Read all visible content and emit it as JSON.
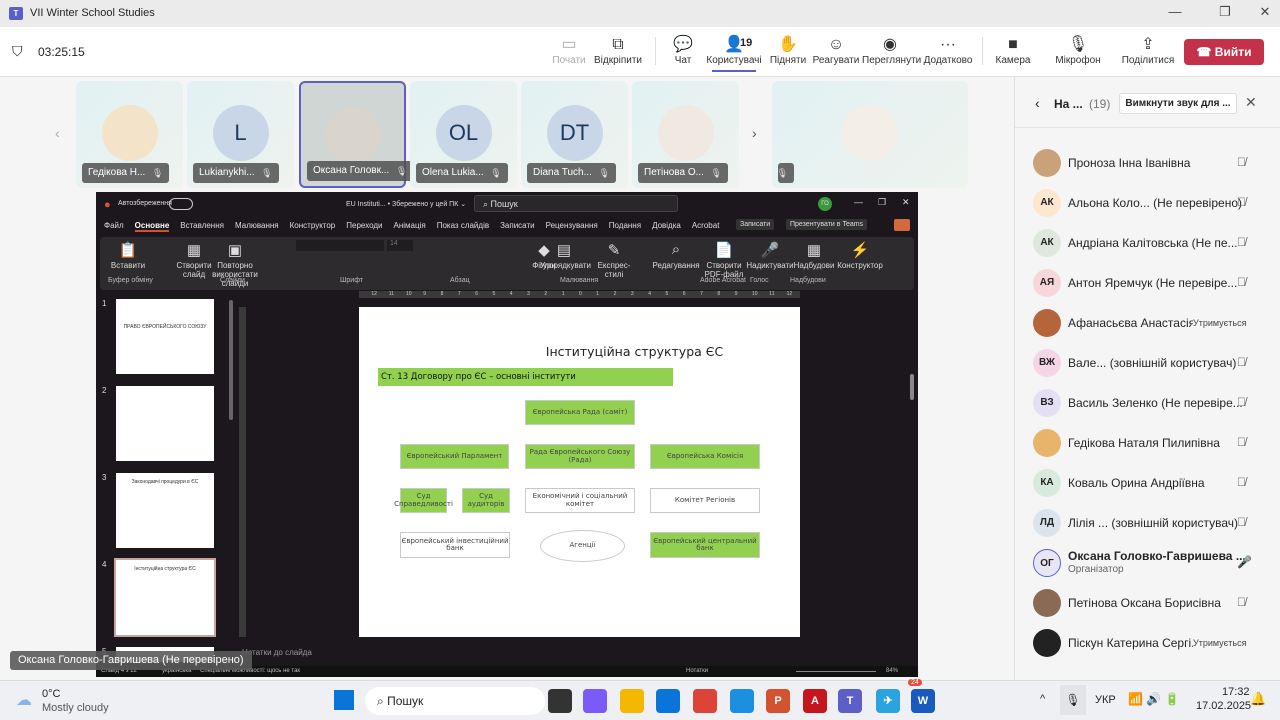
{
  "window": {
    "title": "VII Winter School Studies"
  },
  "meeting": {
    "timer": "03:25:15",
    "participants_count": "19",
    "toolbar": [
      {
        "label": "Почати",
        "icon": "share-screen-icon",
        "disabled": true
      },
      {
        "label": "Відкріпити",
        "icon": "popout-icon"
      },
      {
        "label": "Чат",
        "icon": "chat-icon"
      },
      {
        "label": "Користувачі",
        "icon": "people-icon",
        "active": true
      },
      {
        "label": "Підняти",
        "icon": "raise-hand-icon"
      },
      {
        "label": "Реагувати",
        "icon": "smile-icon"
      },
      {
        "label": "Переглянути",
        "icon": "view-icon"
      },
      {
        "label": "Додатково",
        "icon": "more-icon"
      },
      {
        "label": "Камера",
        "icon": "camera-off-icon"
      },
      {
        "label": "Мікрофон",
        "icon": "mic-off-icon"
      },
      {
        "label": "Поділитися",
        "icon": "share-icon"
      }
    ],
    "leave_label": "Вийти"
  },
  "gallery": [
    {
      "name": "Гедікова Н...",
      "initials": ""
    },
    {
      "name": "Lukianykhi...",
      "initials": "L"
    },
    {
      "name": "Оксана Головк...",
      "initials": ""
    },
    {
      "name": "Olena Lukia...",
      "initials": "OL"
    },
    {
      "name": "Diana Tuch...",
      "initials": "DT"
    },
    {
      "name": "Петінова О...",
      "initials": ""
    }
  ],
  "presenter_label": "Оксана Головко-Гавришева (Не перевірено)",
  "ppt": {
    "autosave": "Автозбереження",
    "filename": "EU Instituti... • Збережено у цей ПК ⌄",
    "search": "Пошук",
    "user_initials": "ГО",
    "tabs": [
      "Файл",
      "Основне",
      "Вставлення",
      "Малювання",
      "Конструктор",
      "Переходи",
      "Анімація",
      "Показ слайдів",
      "Записати",
      "Рецензування",
      "Подання",
      "Довідка",
      "Acrobat"
    ],
    "record_btn": "Записати",
    "teams_btn": "Презентувати в Teams",
    "ribbon_buttons": [
      "Вставити",
      "Створити слайд",
      "Повторно використати слайди",
      "Фігури",
      "Упорядкувати",
      "Експрес-стилі",
      "Редагування",
      "Створити PDF-файл",
      "Надиктувати",
      "Надбудови",
      "Конструктор"
    ],
    "ribbon_groups": [
      "Буфер обміну",
      "Слайди",
      "Шрифт",
      "Абзац",
      "Малювання",
      "Adobe Acrobat",
      "Голос",
      "Надбудови"
    ],
    "font_size": "14",
    "thumbnails": [
      {
        "num": "1",
        "title": "ПРАВО ЄВРОПЕЙСЬКОГО СОЮЗУ"
      },
      {
        "num": "2",
        "title": ""
      },
      {
        "num": "3",
        "title": "Законодавчі процедури в ЄС"
      },
      {
        "num": "4",
        "title": "Інституційна структура ЄС"
      },
      {
        "num": "5",
        "title": ""
      }
    ],
    "notes_placeholder": "Нотатки до слайда",
    "status": {
      "slide": "Слайд 4 з 12",
      "language": "українська",
      "accessibility": "Спеціальні можливості: щось не так",
      "notes": "Нотатки",
      "zoom": "84%"
    },
    "slide": {
      "title": "Інституційна структура ЄС",
      "subtitle": "Ст. 13 Договору про ЄС – основні інститути",
      "boxes": {
        "council_summit": "Європейська Рада (саміт)",
        "parliament": "Європейський Парламент",
        "council": "Рада Європейського Союзу (Рада)",
        "commission": "Європейська Комісія",
        "court_justice": "Суд Справедливості",
        "court_auditors": "Суд аудиторів",
        "ecosoc": "Економічний і соціальний комітет",
        "regions": "Комітет Регіонів",
        "eib": "Європейський інвестиційний банк",
        "agencies": "Агенції",
        "ecb": "Європейський центральний банк"
      }
    }
  },
  "panel": {
    "title": "На ...",
    "count": "(19)",
    "mute_all": "Вимкнути звук для ...",
    "people": [
      {
        "name": "Проноза Інна Іванівна",
        "initials": "",
        "color": "#c9a27a",
        "status": "mic-off"
      },
      {
        "name": "Альона Коло... (Не перевірено)",
        "initials": "АК",
        "color": "#fde7cf",
        "status": "mic-off"
      },
      {
        "name": "Андріана Калітовська (Не пе...",
        "initials": "АК",
        "color": "#dfe8dd",
        "status": "mic-off"
      },
      {
        "name": "Антон Яремчук (Не перевіре...",
        "initials": "АЯ",
        "color": "#f6d8da",
        "status": "mic-off"
      },
      {
        "name": "Афанасьєва Анастасія ...",
        "initials": "",
        "color": "#b5653a",
        "status": "Утримується"
      },
      {
        "name": "Вале...  (зовнішній користувач)",
        "initials": "ВЖ",
        "color": "#f5d6e6",
        "status": "mic-off"
      },
      {
        "name": "Василь Зеленко (Не перевіре...",
        "initials": "ВЗ",
        "color": "#e4dff2",
        "status": "mic-off"
      },
      {
        "name": "Гедікова Наталя Пилипівна",
        "initials": "",
        "color": "#e8b36a",
        "status": "mic-off"
      },
      {
        "name": "Коваль Орина Андріївна",
        "initials": "КА",
        "color": "#d8eadb",
        "status": "mic-off"
      },
      {
        "name": "Лілія ... (зовнішній користувач)",
        "initials": "ЛД",
        "color": "#dbe4ec",
        "status": "mic-off"
      },
      {
        "name": "Оксана Головко-Гавришева ...",
        "initials": "ОГ",
        "color": "#e8e6f4",
        "status": "mic-on",
        "role": "Організатор"
      },
      {
        "name": "Петінова Оксана Борисівна",
        "initials": "",
        "color": "#8a6a55",
        "status": "mic-off"
      },
      {
        "name": "Піскун Катерина Сергі...",
        "initials": "",
        "color": "#222",
        "status": "Утримується"
      }
    ]
  },
  "taskbar": {
    "weather_temp": "0°C",
    "weather_desc": "Mostly cloudy",
    "search": "Пошук",
    "lang": "УКР",
    "time": "17:32",
    "date": "17.02.2025",
    "telegram_badge": "24"
  }
}
